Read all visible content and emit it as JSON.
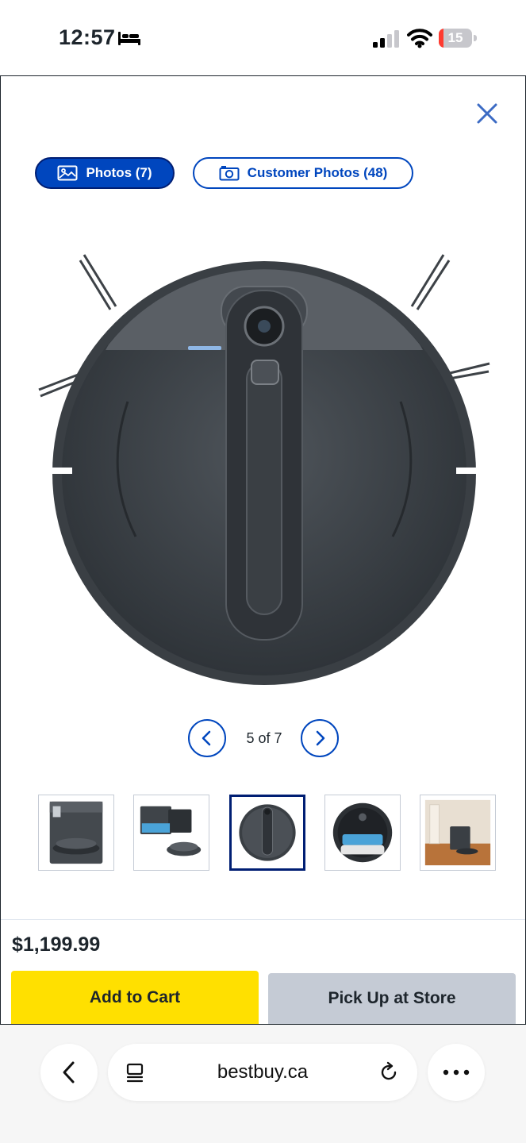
{
  "status_bar": {
    "time": "12:57",
    "battery_level": "15",
    "battery_color": "#ff3b30",
    "icons": [
      "bed-icon",
      "cellular-signal-icon",
      "wifi-icon",
      "battery-icon"
    ]
  },
  "modal": {
    "close_icon": "close-icon",
    "tabs": [
      {
        "label": "Photos (7)",
        "icon": "image-icon",
        "selected": true
      },
      {
        "label": "Customer Photos (48)",
        "icon": "camera-icon",
        "selected": false
      }
    ],
    "image_alt": "Robot vacuum top view",
    "pager": {
      "text": "5 of 7",
      "prev_icon": "chevron-left-icon",
      "next_icon": "chevron-right-icon"
    },
    "thumbnails": [
      {
        "subject": "base station with robot"
      },
      {
        "subject": "open dock and robot"
      },
      {
        "subject": "robot top view",
        "selected": true
      },
      {
        "subject": "robot underside"
      },
      {
        "subject": "dock in room"
      }
    ],
    "price": "$1,199.99",
    "add_to_cart_label": "Add to Cart",
    "pickup_label": "Pick Up at Store"
  },
  "browser": {
    "url": "bestbuy.ca",
    "icons": [
      "back-chevron-icon",
      "tabs-icon",
      "reload-icon",
      "more-icon"
    ]
  },
  "colors": {
    "brand_blue": "#0046be",
    "dark_navy": "#001e73",
    "cart_yellow": "#ffe000",
    "disabled_gray": "#c5cbd5",
    "close_blue": "#3c6bc4"
  }
}
